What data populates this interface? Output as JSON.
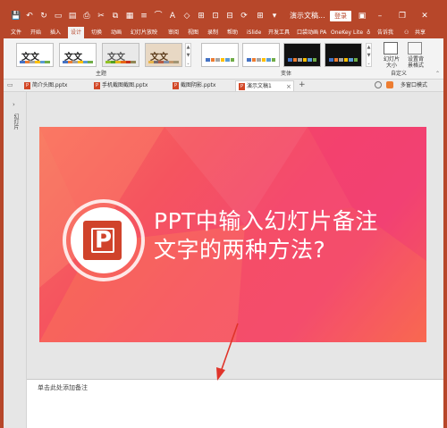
{
  "app": {
    "doc_title": "演示文稿...",
    "login_label": "登录"
  },
  "menu_tabs": [
    "文件",
    "开始",
    "插入",
    "设计",
    "切换",
    "动画",
    "幻灯片放映",
    "审阅",
    "视图",
    "录制",
    "帮助",
    "iSlide",
    "开发工具",
    "口袋动画 PA",
    "OneKey Lite",
    "告诉我",
    "共享"
  ],
  "ribbon": {
    "themes_group_label": "主题",
    "variants_group_label": "变体",
    "customize_group_label": "自定义",
    "theme_sample_text": "文文",
    "slide_size_label": "幻灯片\n大小",
    "format_bg_label": "设置背\n景格式"
  },
  "file_tabs": [
    {
      "name": "简介头图.pptx"
    },
    {
      "name": "手机截图截图.pptx"
    },
    {
      "name": "截图阴影.pptx"
    },
    {
      "name": "演示文稿1"
    }
  ],
  "right_tools": {
    "multiwindow_label": "多窗口模式"
  },
  "side_panel": {
    "label": "幻灯片"
  },
  "slide": {
    "icon_letter": "P",
    "title_line1": "PPT中输入幻灯片备注",
    "title_line2": "文字的两种方法?"
  },
  "notes": {
    "placeholder": "单击此处添加备注"
  },
  "colors": {
    "accent": "#b7472a",
    "slide_gradient": [
      "#f76e5e",
      "#f44a6e",
      "#f96d50"
    ],
    "arrow": "#e0342a"
  }
}
